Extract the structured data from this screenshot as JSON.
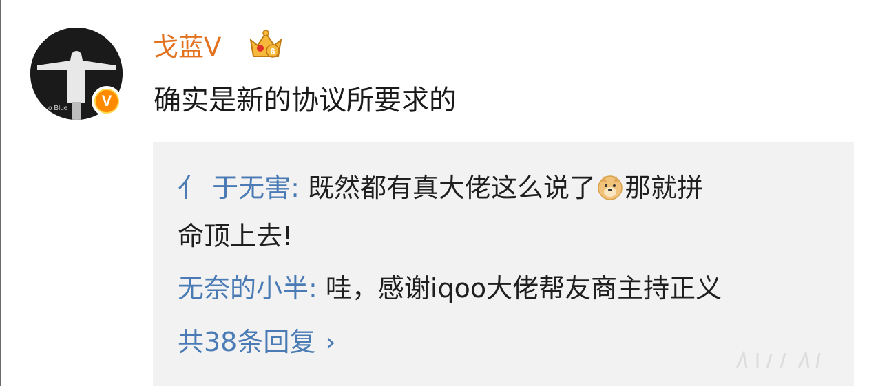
{
  "comment": {
    "username": "戈蓝V",
    "text": "确实是新的协议所要求的",
    "avatar_caption": "o Blue",
    "verified_badge": "V",
    "crown_level": "6"
  },
  "replies": [
    {
      "author": "亻 于无害",
      "colon": ":",
      "text_before_emoji": " 既然都有真大佬这么说了",
      "emoji": "doge-icon",
      "text_after_emoji": "那就拼",
      "continuation": "命顶上去!"
    },
    {
      "author": "无奈的小半",
      "colon": ":",
      "text": " 哇，感谢iqoo大佬帮友商主持正义"
    }
  ],
  "more_replies": {
    "label": "共38条回复",
    "chevron": "›"
  },
  "colors": {
    "username": "#e2721f",
    "link_blue": "#4a7bb5",
    "reply_bg": "#f2f2f2",
    "text": "#1a1a1a",
    "badge_orange": "#ff8a00"
  }
}
